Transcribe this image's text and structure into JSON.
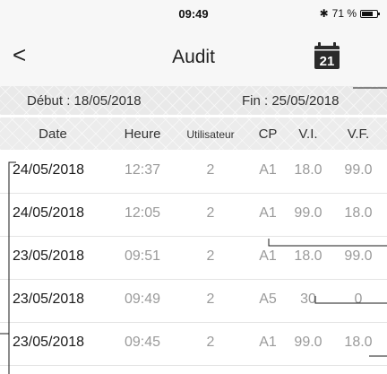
{
  "status_bar": {
    "time": "09:49",
    "bluetooth_symbol": "✱",
    "battery_text": "71 %"
  },
  "nav": {
    "back_symbol": "<",
    "title": "Audit",
    "calendar_day": "21"
  },
  "date_range": {
    "start": "Début : 18/05/2018",
    "end": "Fin : 25/05/2018"
  },
  "table": {
    "headers": {
      "date": "Date",
      "heure": "Heure",
      "utilisateur": "Utilisateur",
      "cp": "CP",
      "vi": "V.I.",
      "vf": "V.F."
    },
    "rows": [
      {
        "date": "24/05/2018",
        "heure": "12:37",
        "user": "2",
        "cp": "A1",
        "vi": "18.0",
        "vf": "99.0"
      },
      {
        "date": "24/05/2018",
        "heure": "12:05",
        "user": "2",
        "cp": "A1",
        "vi": "99.0",
        "vf": "18.0"
      },
      {
        "date": "23/05/2018",
        "heure": "09:51",
        "user": "2",
        "cp": "A1",
        "vi": "18.0",
        "vf": "99.0"
      },
      {
        "date": "23/05/2018",
        "heure": "09:49",
        "user": "2",
        "cp": "A5",
        "vi": "30",
        "vf": "0"
      },
      {
        "date": "23/05/2018",
        "heure": "09:45",
        "user": "2",
        "cp": "A1",
        "vi": "99.0",
        "vf": "18.0"
      }
    ]
  },
  "colors": {
    "text": "#1a1a1a",
    "muted": "#9a9a9a",
    "bar_background": "#f7f7f7",
    "header_background": "#ececec"
  }
}
